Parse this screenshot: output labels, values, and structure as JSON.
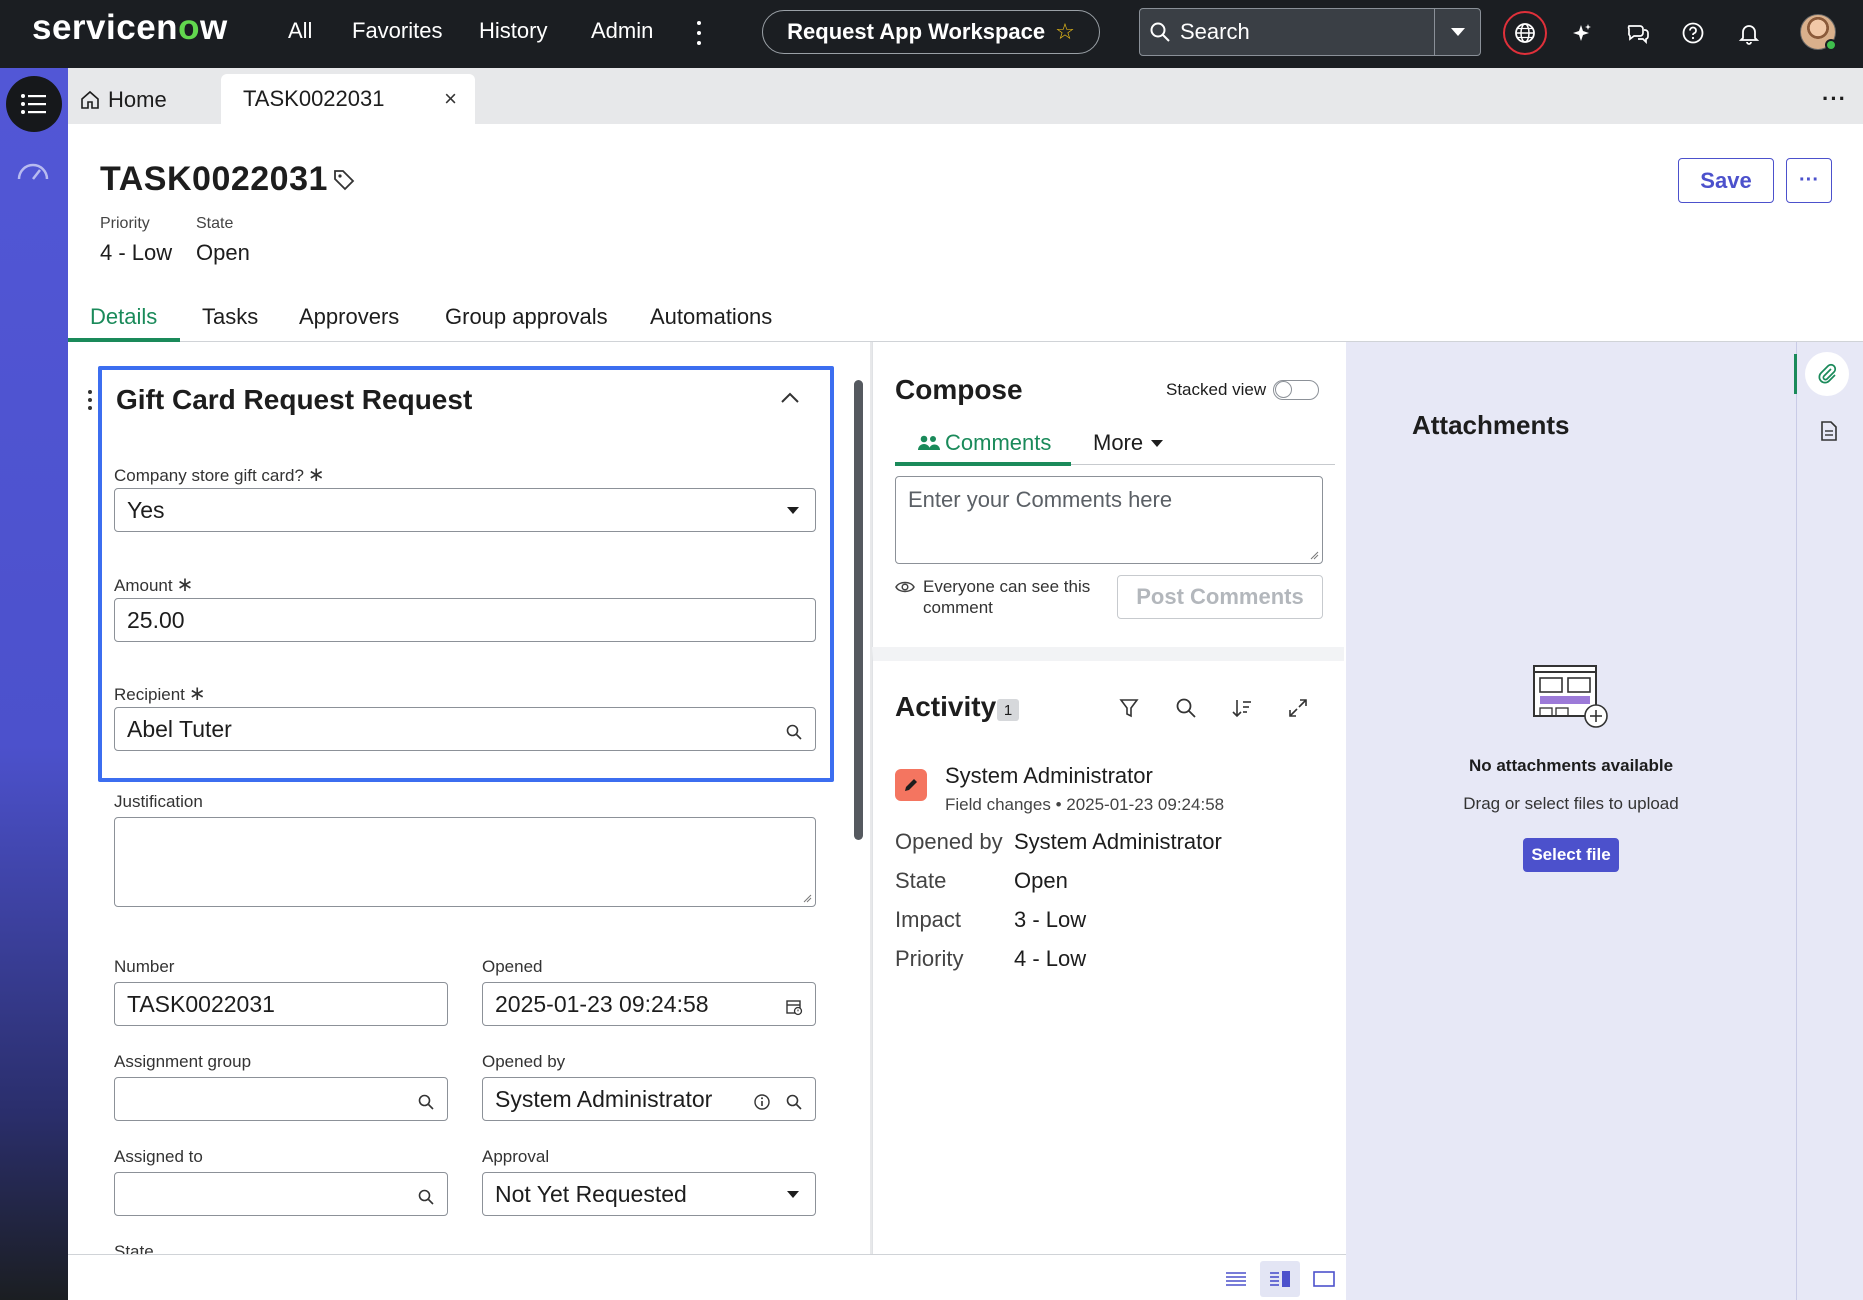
{
  "topbar": {
    "logo_prefix": "servicen",
    "logo_o": "o",
    "logo_suffix": "w",
    "nav": [
      "All",
      "Favorites",
      "History",
      "Admin"
    ],
    "workspace": "Request App Workspace",
    "search_placeholder": "Search"
  },
  "tabs": {
    "home": "Home",
    "active": "TASK0022031",
    "close": "×",
    "more": "···"
  },
  "record": {
    "number": "TASK0022031",
    "priority_label": "Priority",
    "priority_value": "4 - Low",
    "state_label": "State",
    "state_value": "Open",
    "save": "Save",
    "more": "···"
  },
  "detail_tabs": [
    "Details",
    "Tasks",
    "Approvers",
    "Group approvals",
    "Automations"
  ],
  "section": {
    "title": "Gift Card Request Request",
    "company_label": "Company store gift card?",
    "company_value": "Yes",
    "amount_label": "Amount",
    "amount_value": "25.00",
    "recipient_label": "Recipient",
    "recipient_value": "Abel Tuter",
    "required_mark": "∗"
  },
  "form": {
    "justification_label": "Justification",
    "justification_value": "",
    "number_label": "Number",
    "number_value": "TASK0022031",
    "opened_label": "Opened",
    "opened_value": "2025-01-23 09:24:58",
    "assignment_group_label": "Assignment group",
    "assignment_group_value": "",
    "opened_by_label": "Opened by",
    "opened_by_value": "System Administrator",
    "assigned_to_label": "Assigned to",
    "assigned_to_value": "",
    "approval_label": "Approval",
    "approval_value": "Not Yet Requested",
    "state_label": "State"
  },
  "compose": {
    "title": "Compose",
    "stacked_view": "Stacked view",
    "tab_comments": "Comments",
    "tab_more": "More",
    "placeholder": "Enter your Comments here",
    "visibility": "Everyone can see this comment",
    "post": "Post Comments"
  },
  "activity": {
    "title": "Activity",
    "count": "1",
    "user": "System Administrator",
    "subtitle": "Field changes • 2025-01-23 09:24:58",
    "changes": [
      {
        "k": "Opened by",
        "v": "System Administrator"
      },
      {
        "k": "State",
        "v": "Open"
      },
      {
        "k": "Impact",
        "v": "3 - Low"
      },
      {
        "k": "Priority",
        "v": "4 - Low"
      }
    ]
  },
  "attachments": {
    "title": "Attachments",
    "empty": "No attachments available",
    "hint": "Drag or select files to upload",
    "select": "Select file"
  },
  "colors": {
    "accent": "#4c51cc",
    "active_tab": "#1a8a5a",
    "highlight": "#3c6ef0",
    "topbar": "#1b1e22"
  }
}
